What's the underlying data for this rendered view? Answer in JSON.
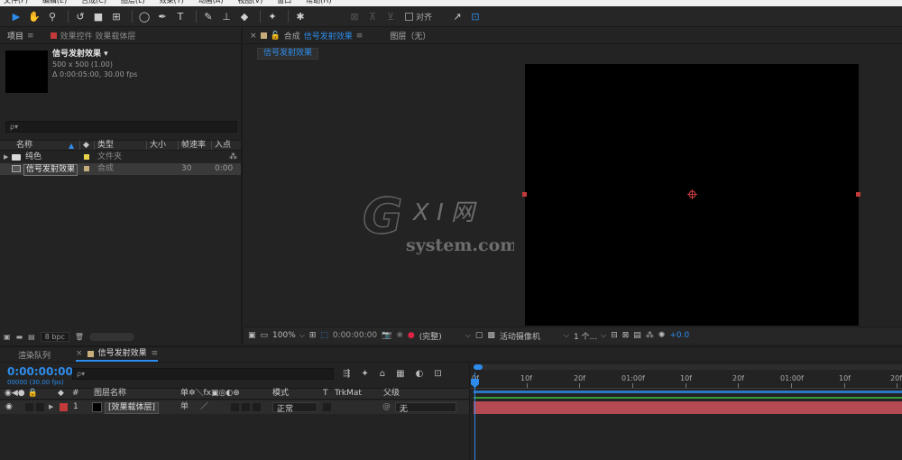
{
  "menubar": {
    "items": [
      "文件(F)",
      "编辑(E)",
      "合成(C)",
      "图层(L)",
      "效果(T)",
      "动画(A)",
      "视图(V)",
      "窗口",
      "帮助(H)"
    ]
  },
  "toolbar": {
    "align_label": "对齐"
  },
  "project": {
    "tab_label": "项目",
    "effects_tab_label": "效果控件 效果载体层",
    "comp_name": "信号发射效果",
    "comp_size": "500 x 500 (1.00)",
    "comp_duration": "Δ 0:00:05:00, 30.00 fps",
    "search_placeholder": "ρ▾",
    "columns": {
      "name": "名称",
      "type": "类型",
      "size": "大小",
      "fps": "帧速率",
      "in": "入点"
    },
    "rows": [
      {
        "name": "纯色",
        "type": "文件夹",
        "fps": "",
        "in": ""
      },
      {
        "name": "信号发射效果",
        "type": "合成",
        "fps": "30",
        "in": "0:00"
      }
    ],
    "bpc": "8 bpc",
    "colors": {
      "folder_swatch": "#e8d44a",
      "comp_swatch": "#c7ad7a"
    }
  },
  "viewer": {
    "tab_comp_prefix": "合成",
    "tab_comp_name": "信号发射效果",
    "tab_layer": "图层（无）",
    "breadcrumb": "信号发射效果",
    "controls": {
      "zoom": "100%",
      "timecode": "0:00:00:00",
      "resolution": "(完整)",
      "camera": "活动摄像机",
      "views": "1 个...",
      "exposure": "+0.0"
    }
  },
  "watermark": {
    "line1": "G X I 网",
    "line2": "system.com"
  },
  "timeline": {
    "tab_render": "渲染队列",
    "tab_comp": "信号发射效果",
    "timecode": "0:00:00:00",
    "timecode_sub": "00000 (30.00 fps)",
    "search_placeholder": "ρ▾",
    "columns": {
      "num": "#",
      "layer_name": "图层名称",
      "mode": "模式",
      "t": "T",
      "trkmat": "TrkMat",
      "parent": "父级"
    },
    "layers": [
      {
        "num": "1",
        "name": "[效果载体层]",
        "mode": "正常",
        "parent": "无"
      }
    ],
    "ruler_ticks": [
      "0f",
      "10f",
      "20f",
      "01:00f",
      "10f",
      "20f",
      "01:00f",
      "10f",
      "20f"
    ]
  },
  "colors": {
    "accent": "#2d8ceb",
    "label_red": "#c23a3a",
    "layer_bar": "#b54a52"
  }
}
